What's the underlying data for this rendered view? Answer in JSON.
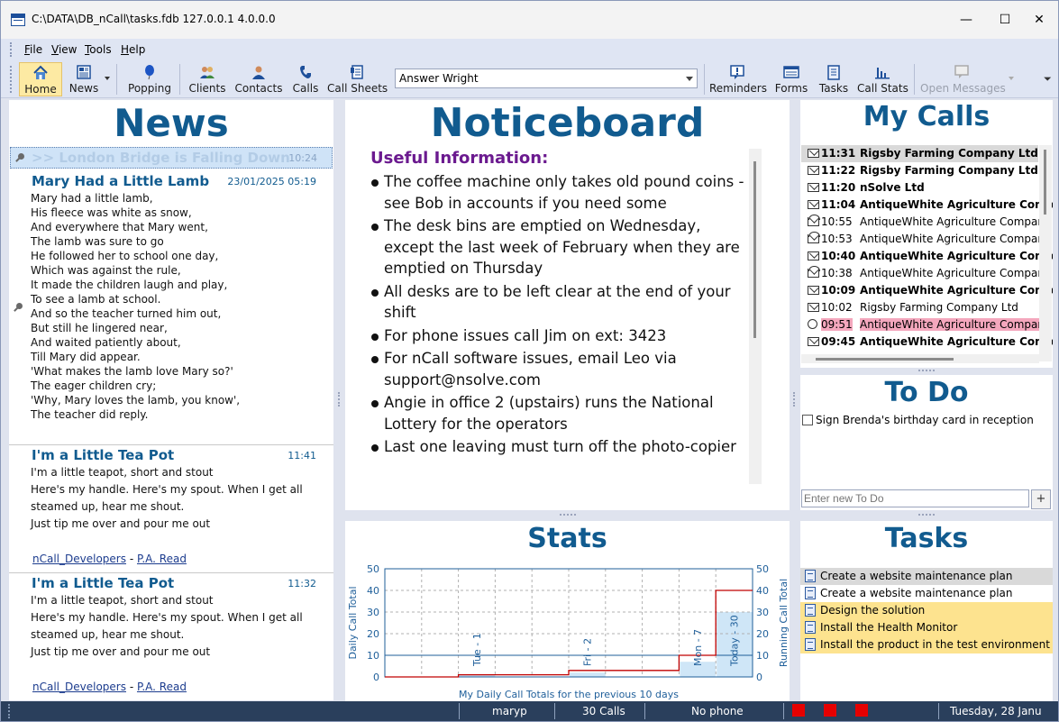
{
  "window": {
    "title": "C:\\DATA\\DB_nCall\\tasks.fdb 127.0.0.1 4.0.0.0"
  },
  "menu": [
    {
      "pre": "",
      "u": "F",
      "post": "ile"
    },
    {
      "pre": "",
      "u": "V",
      "post": "iew"
    },
    {
      "pre": "",
      "u": "T",
      "post": "ools"
    },
    {
      "pre": "",
      "u": "H",
      "post": "elp"
    }
  ],
  "toolbar": {
    "home": "Home",
    "news": "News",
    "popping": "Popping",
    "clients": "Clients",
    "contacts": "Contacts",
    "calls": "Calls",
    "call_sheets": "Call Sheets",
    "operator_select": "Answer Wright",
    "reminders": "Reminders",
    "forms": "Forms",
    "tasks": "Tasks",
    "call_stats": "Call Stats",
    "open_messages": "Open Messages"
  },
  "news": {
    "title": "News",
    "selected": {
      "title": ">> London Bridge is Falling Down",
      "time": "10:24"
    },
    "item1": {
      "title": "Mary Had a Little Lamb",
      "date": "23/01/2025 05:19",
      "lines": [
        "Mary had a little lamb,",
        "His fleece was white as snow,",
        "And everywhere that Mary went,",
        "The lamb was sure to go",
        "He followed her to school one day,",
        "Which was against the rule,",
        "It made the children laugh and play,",
        "To see a lamb at school.",
        "And so the teacher turned him out,",
        "But still he lingered near,",
        "And waited patiently about,",
        "Till Mary did appear.",
        "'What makes the lamb love Mary so?'",
        "The eager children cry;",
        "'Why, Mary loves the lamb, you know',",
        "The teacher did reply."
      ]
    },
    "item2": {
      "title": "I'm a Little Tea Pot",
      "time": "11:41",
      "line1": "I'm a little teapot, short and stout",
      "line2": "Here's my handle. Here's my spout. When I get all steamed up, hear me shout.",
      "line3": "Just tip me over and pour me out",
      "author_group": "nCall_Developers",
      "sep": "-",
      "author": "P.A. Read"
    },
    "item3": {
      "title": "I'm a Little Tea Pot",
      "time": "11:32",
      "line1": "I'm a little teapot, short and stout",
      "line2": "Here's my handle. Here's my spout. When I get all steamed up, hear me shout.",
      "line3": "Just tip me over and pour me out",
      "author_group": "nCall_Developers",
      "sep": "-",
      "author": "P.A. Read"
    }
  },
  "noticeboard": {
    "title": "Noticeboard",
    "subtitle": "Useful Information:",
    "items": [
      "The coffee machine only takes old pound coins - see Bob in accounts if you need some",
      "The desk bins are emptied on Wednesday, except the last week of February when they are emptied on Thursday",
      "All desks are to be left clear at the end of your shift",
      "For phone issues call Jim on ext: 3423",
      "For nCall software issues, email Leo via support@nsolve.com",
      "Angie in office 2 (upstairs) runs the National Lottery for the operators",
      "Last one leaving must turn off the photo-copier"
    ]
  },
  "my_calls": {
    "title": "My Calls",
    "rows": [
      {
        "time": "11:31",
        "company": "Rigsby Farming Company Ltd",
        "unread": true,
        "icon": "envelope-closed-icon"
      },
      {
        "time": "11:22",
        "company": "Rigsby Farming Company Ltd",
        "unread": true,
        "icon": "envelope-closed-icon"
      },
      {
        "time": "11:20",
        "company": "nSolve Ltd",
        "unread": true,
        "icon": "envelope-closed-icon"
      },
      {
        "time": "11:04",
        "company": "AntiqueWhite Agriculture Company",
        "unread": true,
        "icon": "envelope-closed-icon"
      },
      {
        "time": "10:55",
        "company": "AntiqueWhite Agriculture Company",
        "unread": false,
        "icon": "envelope-open-icon"
      },
      {
        "time": "10:53",
        "company": "AntiqueWhite Agriculture Company",
        "unread": false,
        "icon": "envelope-open-icon"
      },
      {
        "time": "10:40",
        "company": "AntiqueWhite Agriculture Company",
        "unread": true,
        "icon": "envelope-closed-icon"
      },
      {
        "time": "10:38",
        "company": "AntiqueWhite Agriculture Company",
        "unread": false,
        "icon": "envelope-open-icon"
      },
      {
        "time": "10:09",
        "company": "AntiqueWhite Agriculture Company",
        "unread": true,
        "icon": "envelope-closed-icon"
      },
      {
        "time": "10:02",
        "company": "Rigsby Farming Company Ltd",
        "unread": false,
        "icon": "envelope-forward-icon"
      },
      {
        "time": "09:51",
        "company": "AntiqueWhite Agriculture Company",
        "unread": false,
        "icon": "clock-icon"
      },
      {
        "time": "09:45",
        "company": "AntiqueWhite Agriculture Company",
        "unread": true,
        "icon": "envelope-closed-icon"
      }
    ]
  },
  "todo": {
    "title": "To Do",
    "items": [
      "Sign Brenda's birthday card in reception"
    ],
    "placeholder": "Enter new To Do",
    "add": "+"
  },
  "tasks": {
    "title": "Tasks",
    "rows": [
      {
        "label": "Create a website maintenance plan",
        "state": "selected"
      },
      {
        "label": "Create a website maintenance plan",
        "state": "normal"
      },
      {
        "label": "Design the solution",
        "state": "highlight"
      },
      {
        "label": "Install the Health Monitor",
        "state": "highlight"
      },
      {
        "label": "Install the product in the test environment",
        "state": "highlight"
      }
    ]
  },
  "stats": {
    "title": "Stats",
    "chart_data": {
      "type": "line",
      "title": "My Daily Call Totals for the previous 10 days",
      "ylabel": "Daily Call Total",
      "y2label": "Running Call Total",
      "ylim": [
        0,
        50
      ],
      "yticks": [
        0,
        10,
        20,
        30,
        40,
        50
      ],
      "grid": true,
      "day_labels": [
        {
          "label": "Tue - 1",
          "index": 3
        },
        {
          "label": "Fri - 2",
          "index": 6
        },
        {
          "label": "Mon - 7",
          "index": 9
        },
        {
          "label": "Today - 30",
          "index": 10
        }
      ],
      "daily": [
        0,
        0,
        0,
        1,
        0,
        0,
        2,
        0,
        0,
        7,
        30
      ],
      "running": [
        0,
        0,
        0,
        1,
        1,
        1,
        3,
        3,
        3,
        10,
        40
      ],
      "series_colors": {
        "daily": "#cfe6f7",
        "running": "#c00000",
        "reference": "#1f5f9a"
      }
    }
  },
  "statusbar": {
    "user": "maryp",
    "calls": "30 Calls",
    "phone": "No phone",
    "date": "Tuesday, 28 Janu"
  }
}
